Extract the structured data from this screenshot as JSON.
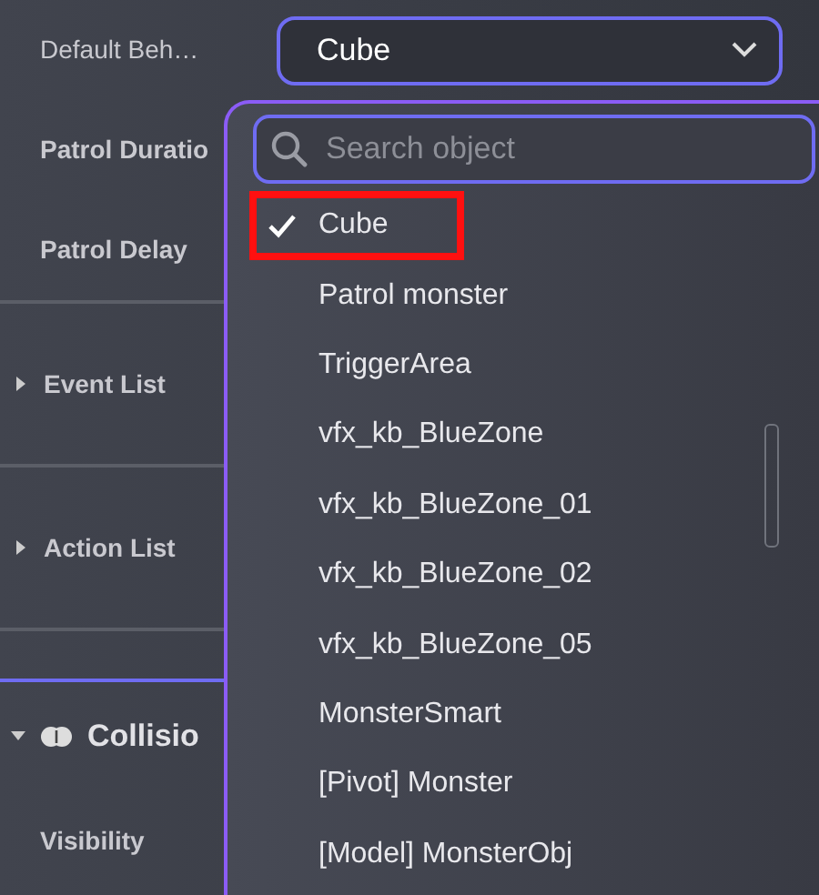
{
  "properties": [
    {
      "kind": "select",
      "label": "Default Beh…",
      "value": "Cube"
    },
    {
      "kind": "field",
      "label": "Patrol Duratio"
    },
    {
      "kind": "field",
      "label": "Patrol Delay"
    },
    {
      "kind": "divider"
    },
    {
      "kind": "group",
      "label": "Event List",
      "expanded": false
    },
    {
      "kind": "divider"
    },
    {
      "kind": "group",
      "label": "Action List",
      "expanded": false
    },
    {
      "kind": "divider"
    },
    {
      "kind": "section-line"
    },
    {
      "kind": "section",
      "label": "Collisio",
      "expanded": true
    },
    {
      "kind": "field",
      "label": "Visibility"
    }
  ],
  "dropdown": {
    "placeholder": "Search object",
    "items": [
      {
        "label": "Cube",
        "selected": true,
        "highlighted": true
      },
      {
        "label": "Patrol monster",
        "selected": false,
        "highlighted": false
      },
      {
        "label": "TriggerArea",
        "selected": false,
        "highlighted": false
      },
      {
        "label": "vfx_kb_BlueZone",
        "selected": false,
        "highlighted": false
      },
      {
        "label": "vfx_kb_BlueZone_01",
        "selected": false,
        "highlighted": false
      },
      {
        "label": "vfx_kb_BlueZone_02",
        "selected": false,
        "highlighted": false
      },
      {
        "label": "vfx_kb_BlueZone_05",
        "selected": false,
        "highlighted": false
      },
      {
        "label": "MonsterSmart",
        "selected": false,
        "highlighted": false
      },
      {
        "label": "[Pivot] Monster",
        "selected": false,
        "highlighted": false
      },
      {
        "label": "[Model] MonsterObj",
        "selected": false,
        "highlighted": false
      }
    ]
  }
}
